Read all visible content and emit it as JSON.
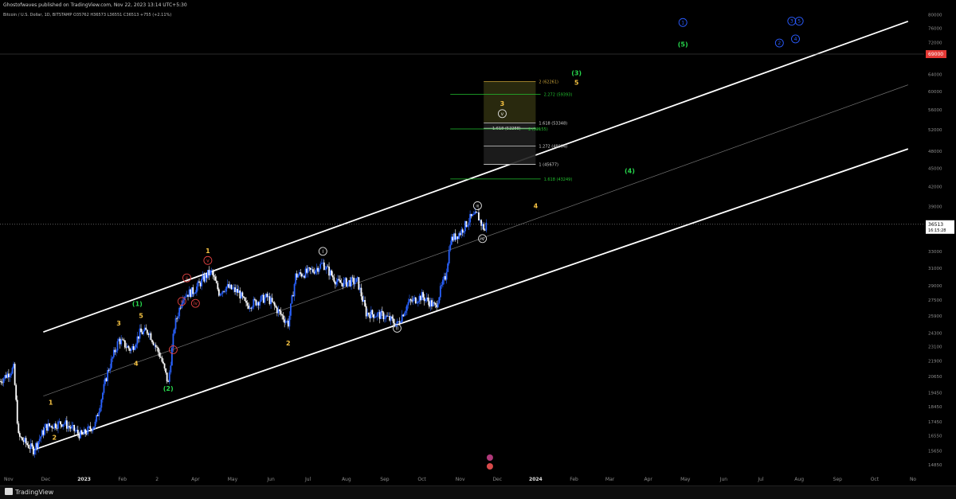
{
  "header": {
    "publisher": "Ghostofwaves published on TradingView.com, Nov 22, 2023 13:14 UTC+5:30",
    "symbol": "Bitcoin / U.S. Dollar, 1D, BITSTAMP",
    "ohlc": "O35762  H36573  L36551  C36513  +755 (+2.11%)"
  },
  "footer": {
    "logo": "TradingView"
  },
  "price_axis": {
    "ticks": [
      "80000",
      "76000",
      "72000",
      "69000",
      "64000",
      "60000",
      "56000",
      "52000",
      "48000",
      "45000",
      "42000",
      "39000",
      "36513",
      "33000",
      "31000",
      "29000",
      "27500",
      "25900",
      "24300",
      "23100",
      "21900",
      "20650",
      "19450",
      "18450",
      "17450",
      "16550",
      "15650",
      "14850"
    ],
    "last_price": "36513",
    "countdown": "16:15:28",
    "highlight_price": "69000"
  },
  "time_axis": {
    "ticks": [
      "Nov",
      "Dec",
      "2023",
      "Feb",
      "2",
      "Apr",
      "May",
      "Jun",
      "Jul",
      "Aug",
      "Sep",
      "Oct",
      "Nov",
      "Dec",
      "2024",
      "Feb",
      "Mar",
      "Apr",
      "May",
      "Jun",
      "Jul",
      "Aug",
      "Sep",
      "Oct",
      "No"
    ]
  },
  "colors": {
    "background": "#000000",
    "candle_up": "#2962ff",
    "candle_down": "#ffffff",
    "channel": "#ffffff",
    "wave_yellow": "#f5c242",
    "wave_green": "#27d64c",
    "wave_red": "#e04040",
    "wave_blue": "#2a5bff",
    "fib_green": "#22c02f",
    "fib_gold": "#c9a23a"
  },
  "chart_data": {
    "type": "candlestick",
    "symbol": "Bitcoin / U.S. Dollar",
    "interval": "1D",
    "exchange": "BITSTAMP",
    "log_scale": true,
    "ylim": [
      14500,
      82000
    ],
    "x_range": [
      "2022-10-25",
      "2024-11-10"
    ],
    "grid": false,
    "price_path": [
      {
        "date": "2022-10-25",
        "close": 20300
      },
      {
        "date": "2022-11-05",
        "close": 21300
      },
      {
        "date": "2022-11-09",
        "close": 16500
      },
      {
        "date": "2022-11-21",
        "close": 15700
      },
      {
        "date": "2022-12-01",
        "close": 17100
      },
      {
        "date": "2022-12-15",
        "close": 17400
      },
      {
        "date": "2022-12-30",
        "close": 16550
      },
      {
        "date": "2023-01-10",
        "close": 17300
      },
      {
        "date": "2023-01-20",
        "close": 21000
      },
      {
        "date": "2023-01-29",
        "close": 23700
      },
      {
        "date": "2023-02-08",
        "close": 22800
      },
      {
        "date": "2023-02-15",
        "close": 24300
      },
      {
        "date": "2023-02-22",
        "close": 24500
      },
      {
        "date": "2023-03-04",
        "close": 22200
      },
      {
        "date": "2023-03-10",
        "close": 20100
      },
      {
        "date": "2023-03-15",
        "close": 24900
      },
      {
        "date": "2023-03-22",
        "close": 28000
      },
      {
        "date": "2023-03-30",
        "close": 28400
      },
      {
        "date": "2023-04-11",
        "close": 30300
      },
      {
        "date": "2023-04-14",
        "close": 30500
      },
      {
        "date": "2023-04-20",
        "close": 28300
      },
      {
        "date": "2023-04-26",
        "close": 28900
      },
      {
        "date": "2023-05-06",
        "close": 28300
      },
      {
        "date": "2023-05-12",
        "close": 26900
      },
      {
        "date": "2023-05-29",
        "close": 27800
      },
      {
        "date": "2023-06-10",
        "close": 25900
      },
      {
        "date": "2023-06-15",
        "close": 25200
      },
      {
        "date": "2023-06-21",
        "close": 30100
      },
      {
        "date": "2023-07-05",
        "close": 30700
      },
      {
        "date": "2023-07-13",
        "close": 31500
      },
      {
        "date": "2023-07-25",
        "close": 29300
      },
      {
        "date": "2023-08-10",
        "close": 29500
      },
      {
        "date": "2023-08-17",
        "close": 26200
      },
      {
        "date": "2023-09-01",
        "close": 25900
      },
      {
        "date": "2023-09-11",
        "close": 25100
      },
      {
        "date": "2023-09-20",
        "close": 27200
      },
      {
        "date": "2023-10-01",
        "close": 27900
      },
      {
        "date": "2023-10-12",
        "close": 26800
      },
      {
        "date": "2023-10-16",
        "close": 28500
      },
      {
        "date": "2023-10-20",
        "close": 30000
      },
      {
        "date": "2023-10-23",
        "close": 33000
      },
      {
        "date": "2023-10-24",
        "close": 34400
      },
      {
        "date": "2023-11-01",
        "close": 35400
      },
      {
        "date": "2023-11-09",
        "close": 37300
      },
      {
        "date": "2023-11-15",
        "close": 37800
      },
      {
        "date": "2023-11-18",
        "close": 36600
      },
      {
        "date": "2023-11-21",
        "close": 35700
      },
      {
        "date": "2023-11-22",
        "close": 36513
      }
    ],
    "channel_lines": [
      {
        "name": "upper",
        "from": {
          "date": "2022-11-29",
          "price": 24400
        },
        "to": {
          "date": "2024-10-28",
          "price": 78000
        }
      },
      {
        "name": "middle",
        "from": {
          "date": "2022-11-29",
          "price": 19200
        },
        "to": {
          "date": "2024-10-28",
          "price": 61500
        }
      },
      {
        "name": "lower",
        "from": {
          "date": "2022-11-21",
          "price": 15700
        },
        "to": {
          "date": "2024-10-28",
          "price": 48400
        }
      }
    ],
    "fib_levels": [
      {
        "label": "2 (62261)",
        "price": 62261,
        "color": "gold"
      },
      {
        "label": "2.272 (59393)",
        "price": 59393,
        "color": "green"
      },
      {
        "label": "1.618 (53348)",
        "price": 53348,
        "color": "white"
      },
      {
        "label": "1.618 (52288)",
        "price": 52288,
        "color": "white"
      },
      {
        "label": "2 (52155)",
        "price": 52155,
        "color": "green"
      },
      {
        "label": "1.272 (48904)",
        "price": 48904,
        "color": "white"
      },
      {
        "label": "1 (45677)",
        "price": 45677,
        "color": "white"
      },
      {
        "label": "1.618 (43249)",
        "price": 43249,
        "color": "green"
      }
    ],
    "wave_labels": [
      {
        "text": "1",
        "date": "2022-12-05",
        "price": 18600,
        "color": "yellow"
      },
      {
        "text": "2",
        "date": "2022-12-08",
        "price": 16300,
        "color": "yellow"
      },
      {
        "text": "3",
        "date": "2023-01-29",
        "price": 25000,
        "color": "yellow"
      },
      {
        "text": "4",
        "date": "2023-02-12",
        "price": 21500,
        "color": "yellow"
      },
      {
        "text": "5",
        "date": "2023-02-16",
        "price": 25700,
        "color": "yellow"
      },
      {
        "text": "(1)",
        "date": "2023-02-13",
        "price": 26900,
        "color": "green"
      },
      {
        "text": "(2)",
        "date": "2023-03-10",
        "price": 19600,
        "color": "green"
      },
      {
        "text": "i",
        "date": "2023-03-14",
        "price": 22700,
        "color": "red"
      },
      {
        "text": "ii",
        "date": "2023-03-21",
        "price": 27200,
        "color": "red"
      },
      {
        "text": "iii",
        "date": "2023-03-25",
        "price": 29700,
        "color": "red"
      },
      {
        "text": "iv",
        "date": "2023-04-01",
        "price": 27000,
        "color": "red"
      },
      {
        "text": "v",
        "date": "2023-04-11",
        "price": 31700,
        "color": "red"
      },
      {
        "text": "1",
        "date": "2023-04-11",
        "price": 32800,
        "color": "yellow"
      },
      {
        "text": "2",
        "date": "2023-06-15",
        "price": 23200,
        "color": "yellow"
      },
      {
        "text": "I",
        "date": "2023-07-13",
        "price": 32800,
        "color": "white"
      },
      {
        "text": "II",
        "date": "2023-09-11",
        "price": 24600,
        "color": "white"
      },
      {
        "text": "III",
        "date": "2023-11-15",
        "price": 38900,
        "color": "white"
      },
      {
        "text": "iv",
        "date": "2023-11-19",
        "price": 34400,
        "color": "white"
      },
      {
        "text": "4",
        "date": "2024-01-01",
        "price": 38800,
        "color": "yellow"
      },
      {
        "text": "3",
        "date": "2023-12-05",
        "price": 56900,
        "color": "yellow"
      },
      {
        "text": "v",
        "date": "2023-12-05",
        "price": 54900,
        "color": "white"
      },
      {
        "text": "5",
        "date": "2024-02-03",
        "price": 61500,
        "color": "yellow"
      },
      {
        "text": "(3)",
        "date": "2024-02-03",
        "price": 63800,
        "color": "green"
      },
      {
        "text": "(4)",
        "date": "2024-03-17",
        "price": 44200,
        "color": "green"
      },
      {
        "text": "(5)",
        "date": "2024-04-29",
        "price": 71000,
        "color": "green"
      },
      {
        "text": "1",
        "date": "2024-04-29",
        "price": 77200,
        "color": "blue"
      },
      {
        "text": "2",
        "date": "2024-07-16",
        "price": 71500,
        "color": "blue"
      },
      {
        "text": "3",
        "date": "2024-07-26",
        "price": 77600,
        "color": "blue"
      },
      {
        "text": "4",
        "date": "2024-07-29",
        "price": 72600,
        "color": "blue"
      },
      {
        "text": "5",
        "date": "2024-08-01",
        "price": 77600,
        "color": "blue"
      }
    ]
  }
}
